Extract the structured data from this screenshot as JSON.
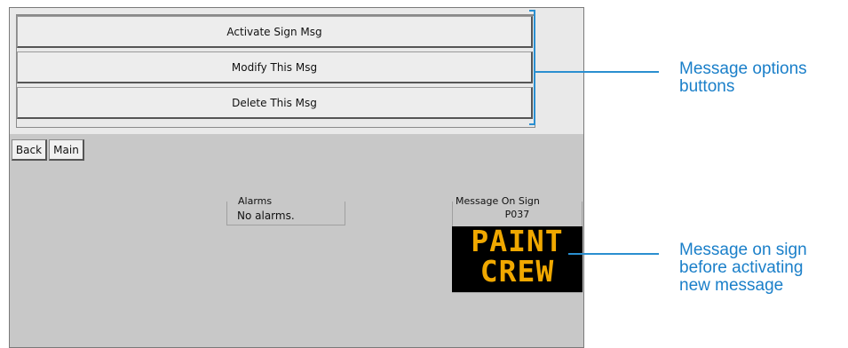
{
  "options": {
    "activate_label": "Activate Sign Msg",
    "modify_label": "Modify This Msg",
    "delete_label": "Delete This Msg"
  },
  "nav": {
    "back_label": "Back",
    "main_label": "Main"
  },
  "alarms": {
    "title": "Alarms",
    "text": "No alarms."
  },
  "sign": {
    "title": "Message On Sign",
    "code": "P037",
    "lines": [
      "PAINT",
      "CREW"
    ],
    "text_color": "#f0a800",
    "background_color": "#000000"
  },
  "callouts": {
    "options_line1": "Message options",
    "options_line2": "buttons",
    "sign_line1": "Message on sign",
    "sign_line2": "before activating",
    "sign_line3": "new message",
    "accent_color": "#1a7fc9"
  }
}
